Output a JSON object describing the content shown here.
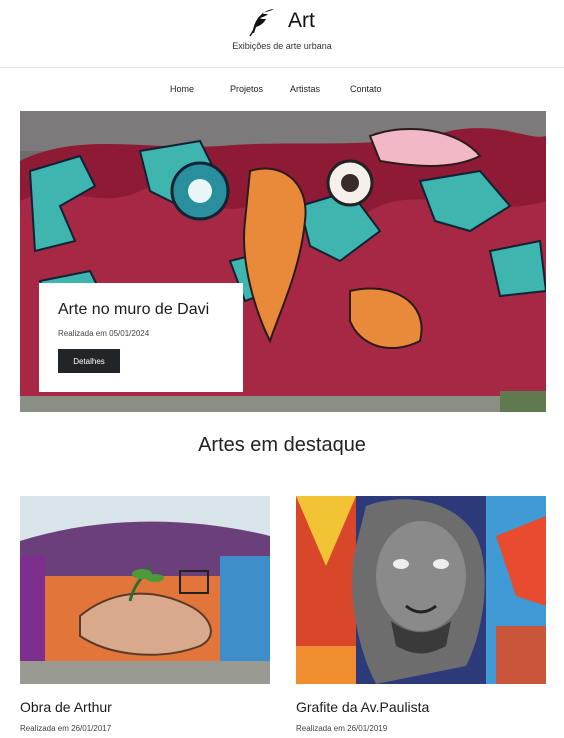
{
  "header": {
    "logo_icon": "feather-quill-icon",
    "title": "Art",
    "subtitle": "Exibições de arte urbana"
  },
  "nav": {
    "items": [
      {
        "label": "Home"
      },
      {
        "label": "Projetos"
      },
      {
        "label": "Artistas"
      },
      {
        "label": "Contato"
      }
    ]
  },
  "hero": {
    "title": "Arte no muro de Davi",
    "date": "Realizada em 05/01/2024",
    "button_label": "Detalhes"
  },
  "featured": {
    "title": "Artes em destaque",
    "cards": [
      {
        "title": "Obra de Arthur",
        "date": "Realizada em 26/01/2017"
      },
      {
        "title": "Grafite da Av.Paulista",
        "date": "Realizada em 26/01/2019"
      }
    ]
  },
  "colors": {
    "button_bg": "#212529",
    "text": "#212529",
    "graffiti_teal": "#3fb5b0",
    "graffiti_red": "#9b1d3a"
  }
}
